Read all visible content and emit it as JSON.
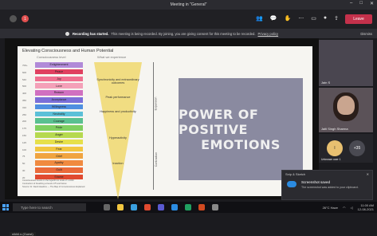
{
  "window": {
    "title": "Meeting in \"General\"",
    "controls": [
      "–",
      "□",
      "✕"
    ]
  },
  "toolbar": {
    "leave_label": "Leave",
    "left_badge": "1",
    "icons": [
      "people-icon",
      "chat-icon",
      "reactions-icon",
      "more-icon",
      "camera-icon",
      "mic-icon",
      "share-icon"
    ]
  },
  "recording": {
    "title": "Recording has started.",
    "message": "This meeting is being recorded. By joining, you are giving consent for this meeting to be recorded.",
    "link": "Privacy policy",
    "dismiss": "Dismiss"
  },
  "slide": {
    "title": "Elevating Consciousness and Human Potential",
    "col1": "Consciousness level",
    "col2": "What we experience",
    "levels": [
      {
        "label": "Enlightenment",
        "num": "700+",
        "color": "#b18ad8"
      },
      {
        "label": "Peace",
        "num": "600",
        "color": "#e04060"
      },
      {
        "label": "Joy",
        "num": "540",
        "color": "#f07090"
      },
      {
        "label": "Love",
        "num": "500",
        "color": "#f4a0b8"
      },
      {
        "label": "Reason",
        "num": "400",
        "color": "#d070c0"
      },
      {
        "label": "Acceptance",
        "num": "350",
        "color": "#7a6fd8"
      },
      {
        "label": "Willingness",
        "num": "310",
        "color": "#4f8fe0"
      },
      {
        "label": "Neutrality",
        "num": "250",
        "color": "#5cc0d8"
      },
      {
        "label": "Courage",
        "num": "200",
        "color": "#59c090"
      },
      {
        "label": "Pride",
        "num": "175",
        "color": "#7fcf60"
      },
      {
        "label": "Anger",
        "num": "150",
        "color": "#b6d94f"
      },
      {
        "label": "Desire",
        "num": "125",
        "color": "#e6e04a"
      },
      {
        "label": "Fear",
        "num": "100",
        "color": "#f2c640"
      },
      {
        "label": "Grief",
        "num": "75",
        "color": "#f0a440"
      },
      {
        "label": "Apathy",
        "num": "50",
        "color": "#f08a40"
      },
      {
        "label": "Guilt",
        "num": "30",
        "color": "#ea6a3a"
      },
      {
        "label": "Shame",
        "num": "20",
        "color": "#e04a30"
      }
    ],
    "desc": [
      "Synchronicity and extraordinary outcomes",
      "Peak performance",
      "Happiness and productivity",
      "Hyperactivity",
      "Inaction"
    ],
    "axis_top": "Expansion",
    "axis_bottom": "Contraction",
    "footnotes": [
      "Consciousness levels on the logarithmic scale of 1-1000",
      "Contraction of breathing at levels 175 and below",
      "Source: Dr. David Hawkins — The Map of Consciousness Explained"
    ],
    "headline_1": "POWER OF POSITIVE",
    "headline_2": "EMOTIONS"
  },
  "presenter_label": "nikhil.s (Guest)",
  "participants": [
    {
      "name": "Jain S",
      "initials": ""
    },
    {
      "name": "Jaiti Singh Sharma",
      "initials": ""
    },
    {
      "name": "",
      "initials": "I",
      "color": "#e8c070"
    },
    {
      "name": "",
      "initials": "+35",
      "color": "#4a4a52"
    }
  ],
  "participant_foot": "Unknown user 1",
  "toast": {
    "header": "Snip & Sketch",
    "title": "Screenshot saved",
    "message": "The screenshot was added to your clipboard."
  },
  "taskbar": {
    "search_placeholder": "Type here to search",
    "weather": "26°C Haze",
    "time": "11:00 AM",
    "date": "12-08-2021"
  }
}
